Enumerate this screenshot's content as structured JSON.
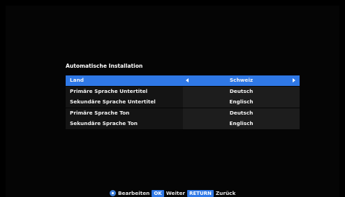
{
  "title": "Automatische Installation",
  "rows": [
    {
      "label": "Land",
      "value": "Schweiz"
    },
    {
      "label": "Primäre Sprache Untertitel",
      "value": "Deutsch"
    },
    {
      "label": "Sekundäre Sprache Untertitel",
      "value": "Englisch"
    },
    {
      "label": "Primäre Sprache Ton",
      "value": "Deutsch"
    },
    {
      "label": "Sekundäre Sprache Ton",
      "value": "Englisch"
    }
  ],
  "selected_row": "Land",
  "footer": {
    "edit_label": "Bearbeiten",
    "ok_key": "OK",
    "ok_label": "Weiter",
    "return_key": "RETURN",
    "return_label": "Zurück"
  },
  "colors": {
    "highlight": "#2f78e6",
    "background": "#000000"
  }
}
